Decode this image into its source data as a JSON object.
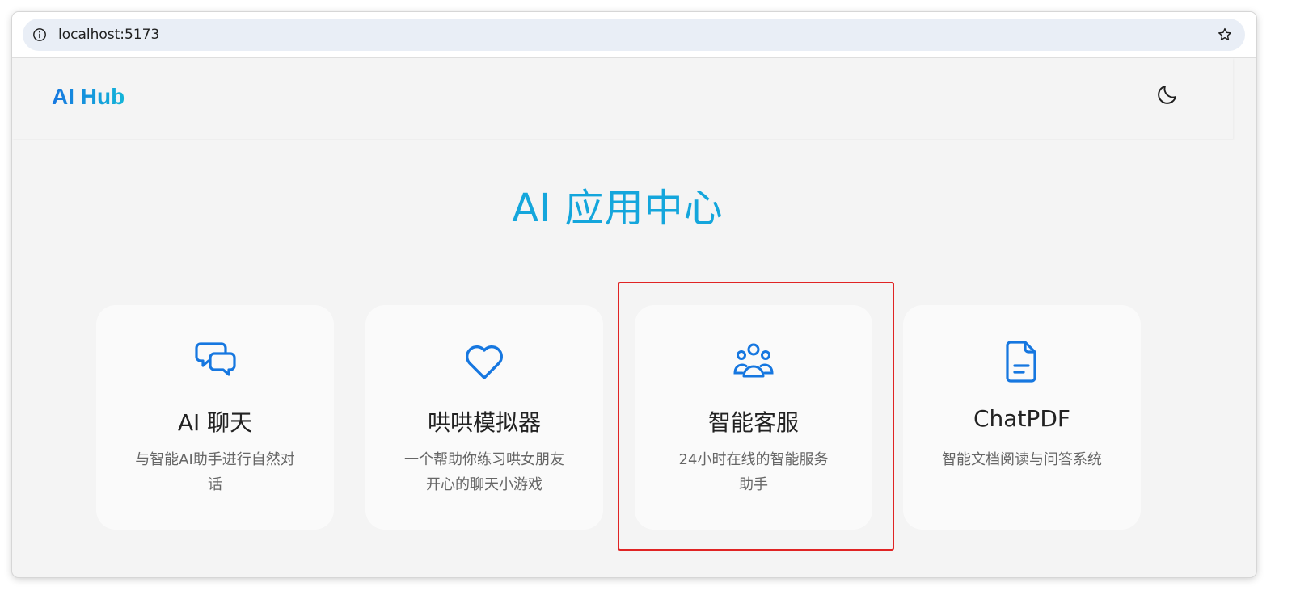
{
  "browser": {
    "url": "localhost:5173"
  },
  "header": {
    "logo": "AI Hub",
    "theme_toggle_icon": "moon-icon"
  },
  "hero": {
    "title": "AI 应用中心"
  },
  "cards": [
    {
      "icon": "chat-bubbles-icon",
      "title": "AI 聊天",
      "desc": "与智能AI助手进行自然对话"
    },
    {
      "icon": "heart-icon",
      "title": "哄哄模拟器",
      "desc": "一个帮助你练习哄女朋友开心的聊天小游戏"
    },
    {
      "icon": "users-group-icon",
      "title": "智能客服",
      "desc": "24小时在线的智能服务助手"
    },
    {
      "icon": "document-icon",
      "title": "ChatPDF",
      "desc": "智能文档阅读与问答系统"
    }
  ],
  "colors": {
    "accent": "#1677e0",
    "title": "#14a6dc",
    "highlight": "#e02424",
    "page_bg": "#f4f4f4",
    "card_bg": "#fafafa"
  }
}
